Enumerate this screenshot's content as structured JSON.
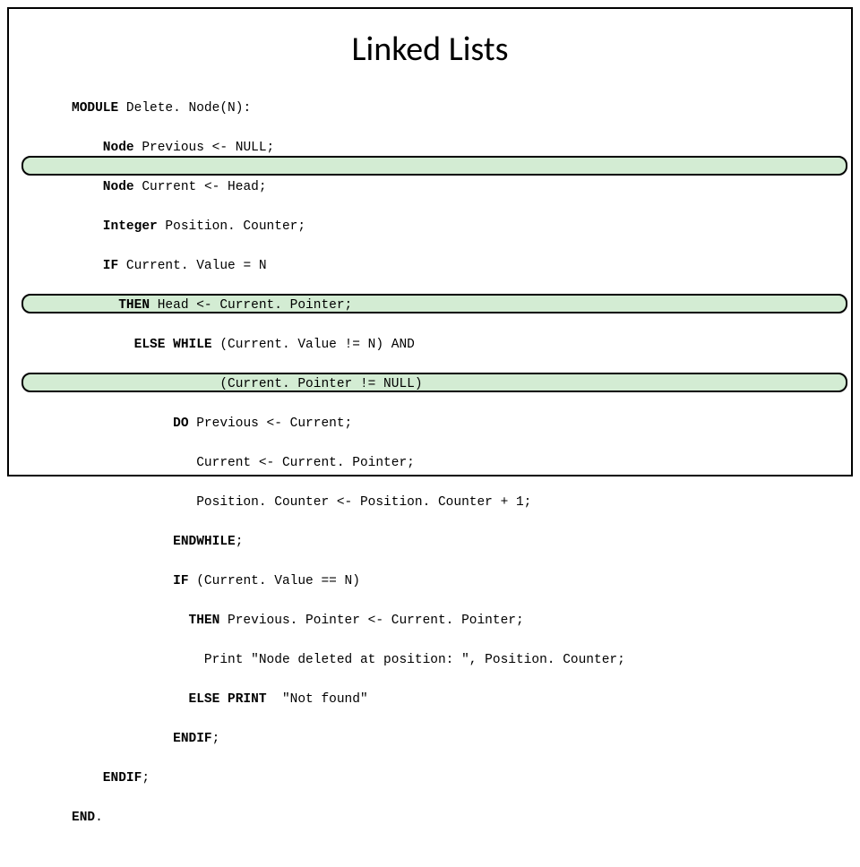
{
  "title": "Linked Lists",
  "code": {
    "l01a": "MODULE",
    "l01b": " Delete. Node(N):",
    "l02a": "    Node",
    "l02b": " Previous <- NULL;",
    "l03a": "    Node",
    "l03b": " Current <- Head;",
    "l04a": "    Integer",
    "l04b": " Position. Counter;",
    "l05a": "    IF",
    "l05b": " Current. Value = N",
    "l06a": "      THEN",
    "l06b": " Head <- Current. Pointer;",
    "l07a": "        ELSE WHILE",
    "l07b": " (Current. Value != N) AND",
    "l08": "                   (Current. Pointer != NULL)",
    "l09a": "             DO",
    "l09b": " Previous <- Current;",
    "l10": "                Current <- Current. Pointer;",
    "l11": "                Position. Counter <- Position. Counter + 1;",
    "l12a": "             ENDWHILE",
    "l12b": ";",
    "l13a": "             IF",
    "l13b": " (Current. Value == N)",
    "l14a": "               THEN",
    "l14b": " Previous. Pointer <- Current. Pointer;",
    "l15": "                 Print \"Node deleted at position: \", Position. Counter;",
    "l16a": "               ELSE PRINT",
    "l16b": "  \"Not found\"",
    "l17a": "             ENDIF",
    "l17b": ";",
    "l18a": "    ENDIF",
    "l18b": ";",
    "l19a": "END",
    "l19b": "."
  }
}
